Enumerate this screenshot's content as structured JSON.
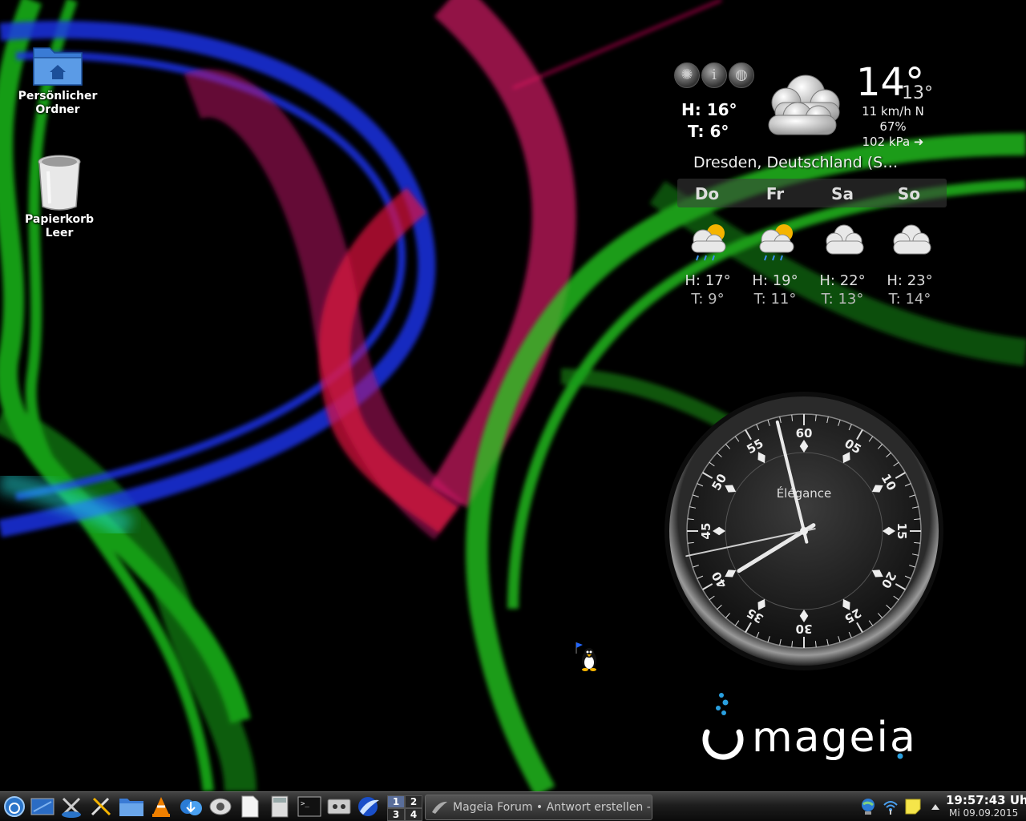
{
  "desktop": {
    "icons": [
      {
        "label_line1": "Persönlicher",
        "label_line2": "Ordner",
        "icon": "home-folder-icon"
      },
      {
        "label_line1": "Papierkorb",
        "label_line2": "Leer",
        "icon": "trash-icon"
      }
    ]
  },
  "weather": {
    "buttons": [
      "sun-icon",
      "info-icon",
      "globe-icon"
    ],
    "today_high": "H: 16°",
    "today_low": "T: 6°",
    "current_temp": "14°",
    "current_min": "13°",
    "wind": "11 km/h N",
    "humidity": "67%",
    "pressure": "102 kPa ➜",
    "location": "Dresden, Deutschland (S…",
    "forecast": [
      {
        "day": "Do",
        "high": "H: 17°",
        "low": "T: 9°",
        "icon": "rain-sun-cloud-icon"
      },
      {
        "day": "Fr",
        "high": "H: 19°",
        "low": "T: 11°",
        "icon": "rain-sun-cloud-icon"
      },
      {
        "day": "Sa",
        "high": "H: 22°",
        "low": "T: 13°",
        "icon": "cloud-icon"
      },
      {
        "day": "So",
        "high": "H: 23°",
        "low": "T: 14°",
        "icon": "cloud-icon"
      }
    ]
  },
  "clock_widget": {
    "brand": "Élégance",
    "numbers": [
      "60",
      "05",
      "10",
      "15",
      "20",
      "25",
      "30",
      "35",
      "40",
      "45",
      "50",
      "55"
    ],
    "time": {
      "hours": 19,
      "minutes": 57,
      "seconds": 43
    }
  },
  "brand": {
    "text": "mageia"
  },
  "taskbar": {
    "launchers": [
      "menu-icon",
      "desktop-icon",
      "system-settings-icon",
      "tools-icon",
      "file-manager-icon",
      "vlc-icon",
      "download-icon",
      "phone-icon",
      "document-icon",
      "calculator-icon",
      "terminal-icon",
      "tape-icon",
      "browser-icon"
    ],
    "pager": [
      "1",
      "2",
      "3",
      "4"
    ],
    "active_desktop": "1",
    "task": {
      "label": "Mageia Forum • Antwort erstellen -",
      "icon": "browser-icon"
    },
    "tray": [
      "network-globe-icon",
      "wifi-icon",
      "notes-icon",
      "expand-icon"
    ],
    "clock": {
      "time": "19:57:43 Uhr",
      "date": "Mi 09.09.2015"
    }
  },
  "colors": {
    "accent_blue": "#1e90ff",
    "wave_green": "#22cc22",
    "wave_red": "#e0144a",
    "wave_blue": "#1133ee",
    "panel": "#1b1b1b"
  }
}
